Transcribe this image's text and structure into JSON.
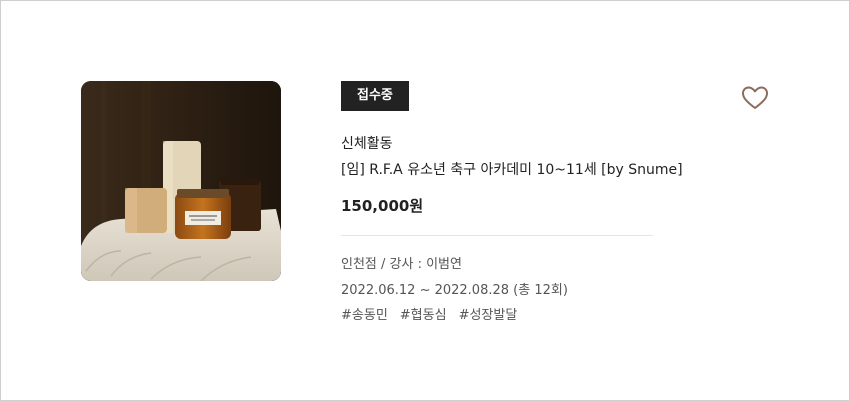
{
  "product": {
    "status_badge": "접수중",
    "category": "신체활동",
    "title": "[임] R.F.A 유소년 축구 아카데미 10~11세 [by Snume]",
    "price": "150,000원",
    "location_instructor": "인천점 / 강사 : 이범연",
    "period": "2022.06.12 ~ 2022.08.28 (총 12회)",
    "tags": [
      "#송동민",
      "#협동심",
      "#성장발달"
    ],
    "thumbnail_icon": "candles-photo",
    "favorite_icon": "heart-outline-icon"
  },
  "colors": {
    "badge_bg": "#222222",
    "heart_stroke": "#8a6d5a",
    "border": "#cfcfcf"
  }
}
